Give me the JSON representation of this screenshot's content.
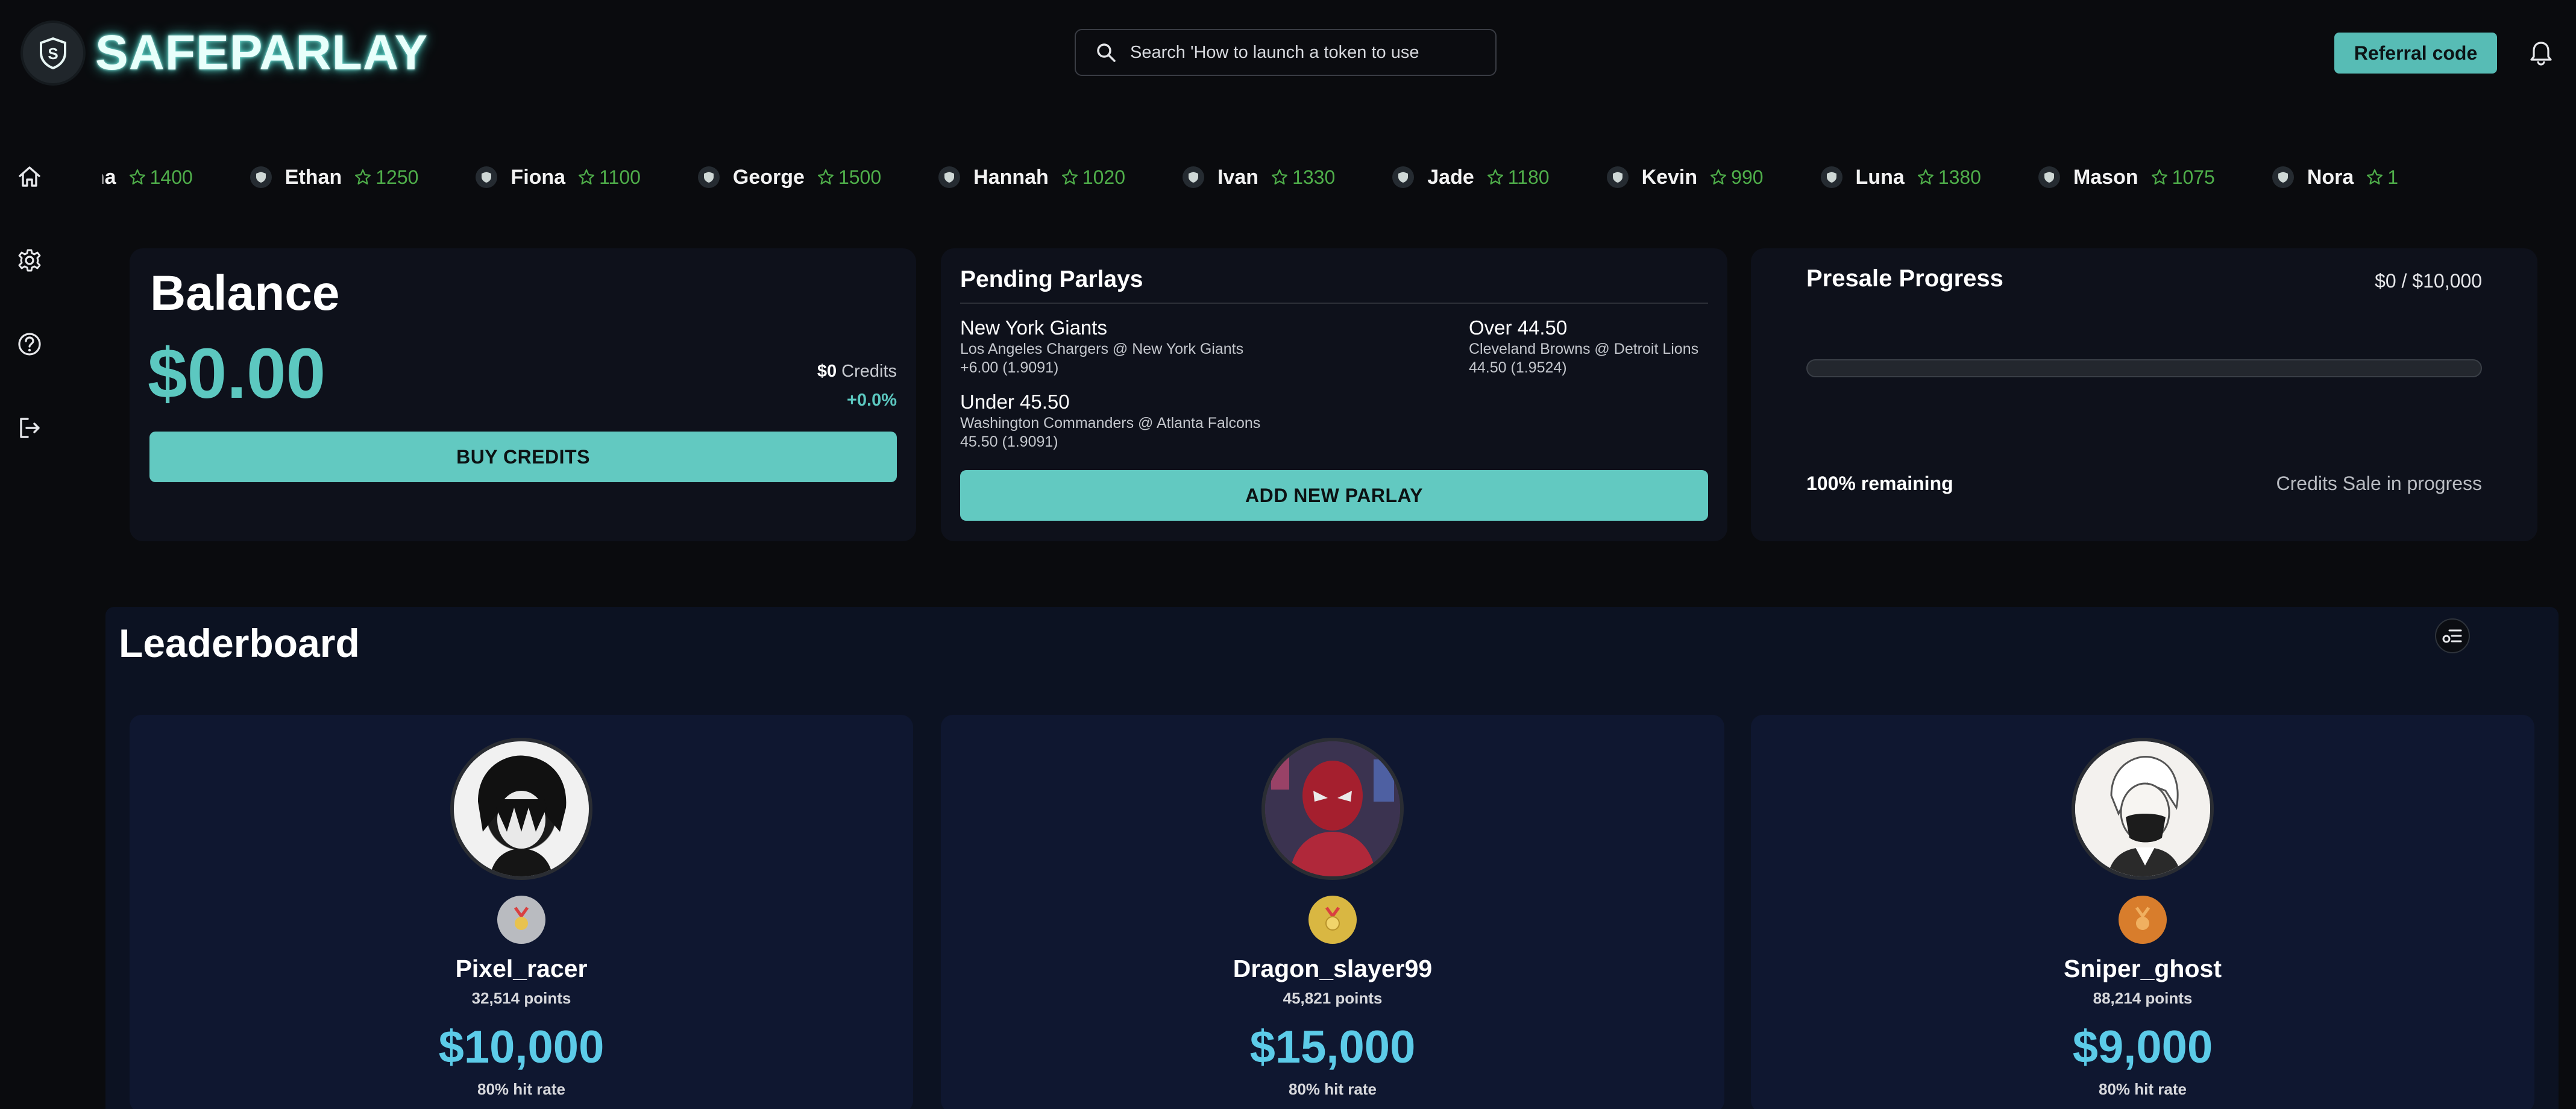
{
  "header": {
    "brand": "SAFEPARLAY",
    "search_placeholder": "Search 'How to launch a token to use",
    "referral_label": "Referral code"
  },
  "sidebar": {
    "items": [
      {
        "icon": "home-icon"
      },
      {
        "icon": "gear-icon"
      },
      {
        "icon": "help-icon"
      },
      {
        "icon": "logout-icon"
      }
    ]
  },
  "ticker": [
    {
      "name": "Diana",
      "score": "1400"
    },
    {
      "name": "Ethan",
      "score": "1250"
    },
    {
      "name": "Fiona",
      "score": "1100"
    },
    {
      "name": "George",
      "score": "1500"
    },
    {
      "name": "Hannah",
      "score": "1020"
    },
    {
      "name": "Ivan",
      "score": "1330"
    },
    {
      "name": "Jade",
      "score": "1180"
    },
    {
      "name": "Kevin",
      "score": "990"
    },
    {
      "name": "Luna",
      "score": "1380"
    },
    {
      "name": "Mason",
      "score": "1075"
    },
    {
      "name": "Nora",
      "score": "1"
    }
  ],
  "balance": {
    "title": "Balance",
    "amount": "$0.00",
    "credits_value": "$0",
    "credits_label": "Credits",
    "change": "+0.0%",
    "buy_label": "BUY CREDITS"
  },
  "parlays": {
    "title": "Pending Parlays",
    "items": [
      {
        "pick": "New York Giants",
        "game": "Los Angeles Chargers @ New York Giants",
        "line": "+6.00 (1.9091)"
      },
      {
        "pick": "Over 44.50",
        "game": "Cleveland Browns @ Detroit Lions",
        "line": "44.50 (1.9524)"
      },
      {
        "pick": "Under 45.50",
        "game": "Washington Commanders @ Atlanta Falcons",
        "line": "45.50 (1.9091)"
      }
    ],
    "add_label": "ADD NEW PARLAY"
  },
  "presale": {
    "title": "Presale Progress",
    "total": "$0 / $10,000",
    "progress": 0,
    "remaining": "100% remaining",
    "status": "Credits Sale in progress"
  },
  "leaderboard": {
    "title": "Leaderboard",
    "entries": [
      {
        "name": "Pixel_racer",
        "points": "32,514 points",
        "amount": "$10,000",
        "rate": "80% hit rate",
        "medal": "silver",
        "medal_color": "#b9bbc0"
      },
      {
        "name": "Dragon_slayer99",
        "points": "45,821 points",
        "amount": "$15,000",
        "rate": "80% hit rate",
        "medal": "gold",
        "medal_color": "#d9b742"
      },
      {
        "name": "Sniper_ghost",
        "points": "88,214 points",
        "amount": "$9,000",
        "rate": "80% hit rate",
        "medal": "bronze",
        "medal_color": "#d87d2c"
      }
    ]
  },
  "colors": {
    "accent": "#5cc8c0",
    "ticker_score": "#4fae4a",
    "amount": "#5ccbe8"
  }
}
